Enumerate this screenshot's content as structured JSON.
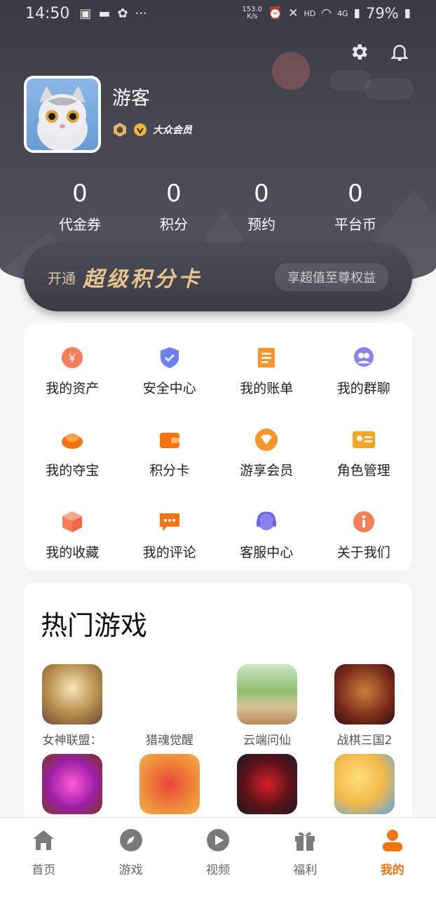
{
  "status_bar": {
    "time": "14:50",
    "net_speed": "153.0\nK/s",
    "hd": "HD",
    "signal": "4G",
    "battery": "79%"
  },
  "profile": {
    "username": "游客",
    "member_label": "大众会员"
  },
  "stats": [
    {
      "value": "0",
      "label": "代金券"
    },
    {
      "value": "0",
      "label": "积分"
    },
    {
      "value": "0",
      "label": "预约"
    },
    {
      "value": "0",
      "label": "平台币"
    }
  ],
  "vip_card": {
    "open": "开通",
    "title": "超级积分卡",
    "benefit": "享超值至尊权益"
  },
  "menu": [
    {
      "label": "我的资产",
      "icon": "yen-icon"
    },
    {
      "label": "安全中心",
      "icon": "shield-icon"
    },
    {
      "label": "我的账单",
      "icon": "bill-icon"
    },
    {
      "label": "我的群聊",
      "icon": "chat-group-icon"
    },
    {
      "label": "我的夺宝",
      "icon": "treasure-icon"
    },
    {
      "label": "积分卡",
      "icon": "wallet-icon"
    },
    {
      "label": "游享会员",
      "icon": "vip-icon"
    },
    {
      "label": "角色管理",
      "icon": "id-card-icon"
    },
    {
      "label": "我的收藏",
      "icon": "cube-icon"
    },
    {
      "label": "我的评论",
      "icon": "comment-icon"
    },
    {
      "label": "客服中心",
      "icon": "headset-icon"
    },
    {
      "label": "关于我们",
      "icon": "info-icon"
    }
  ],
  "hot_games": {
    "title": "热门游戏",
    "row1": [
      {
        "name": "女神联盟："
      },
      {
        "name": "猎魂觉醒"
      },
      {
        "name": "云端问仙"
      },
      {
        "name": "战棋三国2"
      }
    ],
    "row2": [
      {
        "name": ""
      },
      {
        "name": ""
      },
      {
        "name": ""
      },
      {
        "name": ""
      }
    ]
  },
  "tabs": [
    {
      "label": "首页",
      "icon": "home-icon"
    },
    {
      "label": "游戏",
      "icon": "compass-icon"
    },
    {
      "label": "视频",
      "icon": "play-icon"
    },
    {
      "label": "福利",
      "icon": "gift-icon"
    },
    {
      "label": "我的",
      "icon": "profile-icon"
    }
  ],
  "colors": {
    "accent": "#f5740f",
    "header_bg": "#3a3b45",
    "gold": "#e6c48e"
  }
}
